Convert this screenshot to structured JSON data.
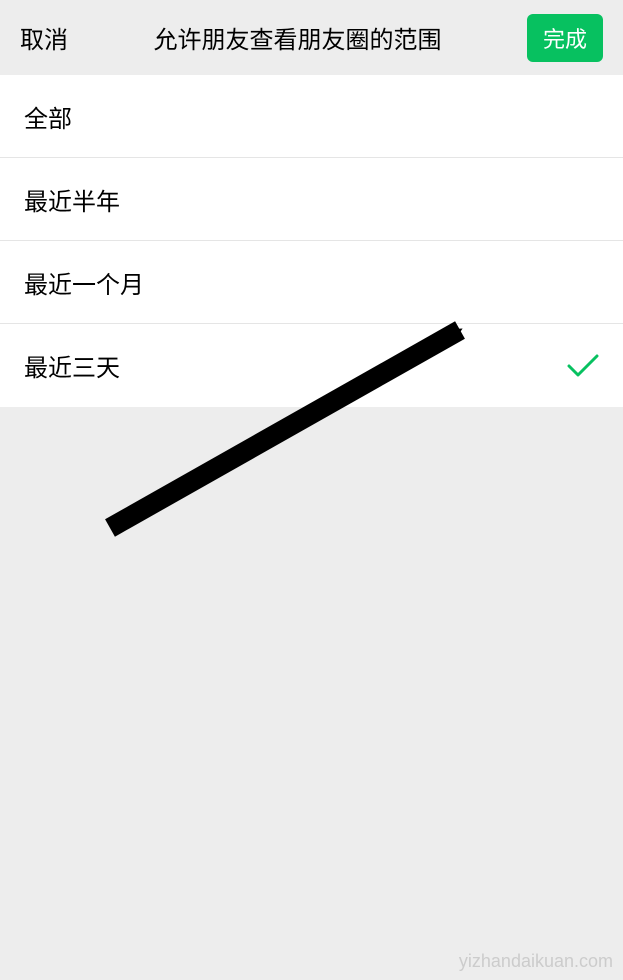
{
  "header": {
    "cancel_label": "取消",
    "title": "允许朋友查看朋友圈的范围",
    "done_label": "完成"
  },
  "options": [
    {
      "label": "全部",
      "selected": false
    },
    {
      "label": "最近半年",
      "selected": false
    },
    {
      "label": "最近一个月",
      "selected": false
    },
    {
      "label": "最近三天",
      "selected": true
    }
  ],
  "watermark": "yizhandaikuan.com",
  "colors": {
    "accent_green": "#07c160",
    "check_green": "#07c160"
  }
}
